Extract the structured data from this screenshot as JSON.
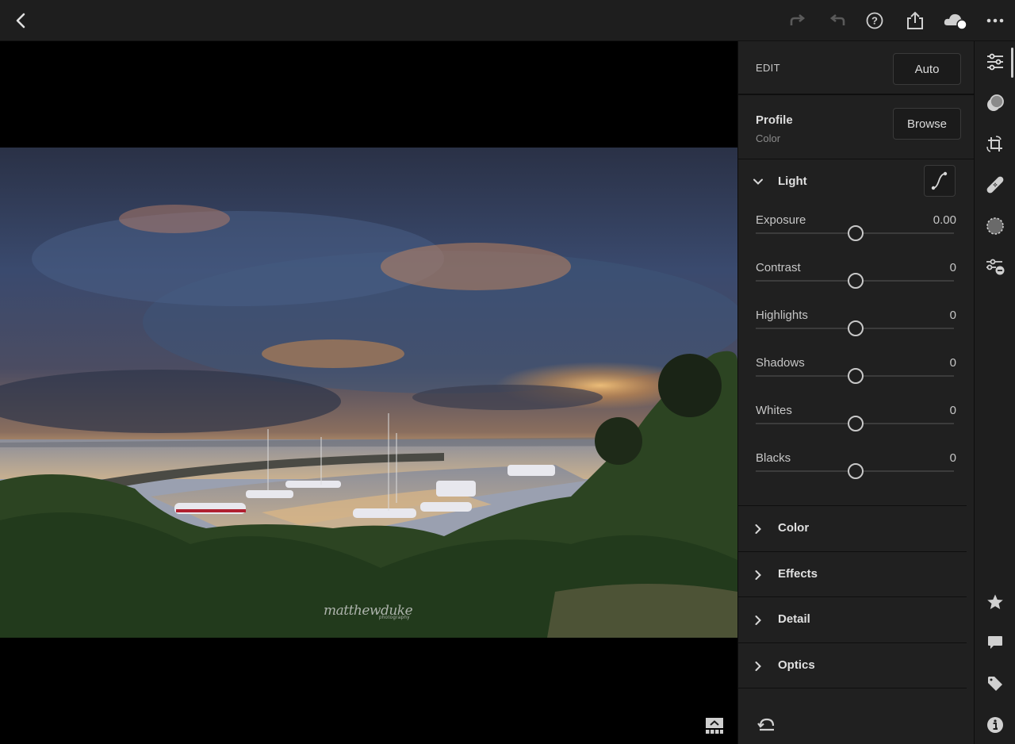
{
  "topbar": {
    "back_icon": "chevron-left-icon",
    "actions": [
      {
        "name": "redo",
        "icon": "redo-icon",
        "enabled": false
      },
      {
        "name": "undo",
        "icon": "undo-icon",
        "enabled": false
      },
      {
        "name": "help",
        "icon": "help-icon",
        "enabled": true
      },
      {
        "name": "share",
        "icon": "share-icon",
        "enabled": true
      },
      {
        "name": "cloud-sync",
        "icon": "cloud-sync-icon",
        "enabled": true
      },
      {
        "name": "more",
        "icon": "more-icon",
        "enabled": true
      }
    ]
  },
  "photo": {
    "watermark": "matthewduke",
    "watermark_sub": "photography"
  },
  "panel": {
    "edit_label": "EDIT",
    "auto_label": "Auto",
    "profile_title": "Profile",
    "profile_value": "Color",
    "browse_label": "Browse",
    "light": {
      "title": "Light",
      "expanded": true,
      "sliders": [
        {
          "label": "Exposure",
          "value": "0.00",
          "position": 0.5
        },
        {
          "label": "Contrast",
          "value": "0",
          "position": 0.5
        },
        {
          "label": "Highlights",
          "value": "0",
          "position": 0.5
        },
        {
          "label": "Shadows",
          "value": "0",
          "position": 0.5
        },
        {
          "label": "Whites",
          "value": "0",
          "position": 0.5
        },
        {
          "label": "Blacks",
          "value": "0",
          "position": 0.5
        }
      ]
    },
    "sections": [
      {
        "title": "Color"
      },
      {
        "title": "Effects"
      },
      {
        "title": "Detail"
      },
      {
        "title": "Optics"
      }
    ]
  },
  "rail": {
    "tools": [
      "edit-sliders-icon",
      "presets-icon",
      "crop-icon",
      "healing-icon",
      "masking-icon",
      "versions-icon"
    ],
    "info": [
      "star-icon",
      "comment-icon",
      "tag-icon",
      "info-icon"
    ]
  },
  "colors": {
    "panel_bg": "#202020",
    "topbar_bg": "#1e1e1e",
    "text": "#d6d6d6"
  }
}
